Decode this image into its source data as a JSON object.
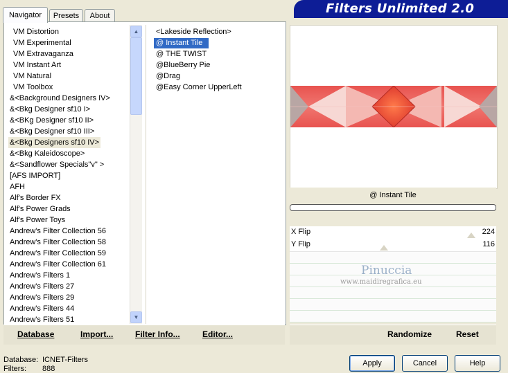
{
  "app_title": "Filters Unlimited 2.0",
  "tabs": [
    "Navigator",
    "Presets",
    "About"
  ],
  "categories": [
    "VM Distortion",
    "VM Experimental",
    "VM Extravaganza",
    "VM Instant Art",
    "VM Natural",
    "VM Toolbox",
    "&<Background Designers IV>",
    "&<Bkg Designer sf10 I>",
    "&<BKg Designer sf10 II>",
    "&<Bkg Designer sf10 III>",
    "&<Bkg Designers sf10 IV>",
    "&<Bkg Kaleidoscope>",
    "&<Sandflower Specials\"v\" >",
    "[AFS IMPORT]",
    "AFH",
    "Alf's Border FX",
    "Alf's Power Grads",
    "Alf's Power Toys",
    "Andrew's Filter Collection 56",
    "Andrew's Filter Collection 58",
    "Andrew's Filter Collection 59",
    "Andrew's Filter Collection 61",
    "Andrew's Filters 1",
    "Andrew's Filters 27",
    "Andrew's Filters 29",
    "Andrew's Filters 44",
    "Andrew's Filters 51"
  ],
  "filters": [
    "<Lakeside Reflection>",
    "@ Instant Tile",
    "@ THE TWIST",
    "@BlueBerry Pie",
    "@Drag",
    "@Easy Corner UpperLeft"
  ],
  "selected_filter_name": "@ Instant Tile",
  "sliders": [
    {
      "label": "X Flip",
      "value": "224"
    },
    {
      "label": "Y Flip",
      "value": "116"
    }
  ],
  "watermark": {
    "line1": "Pinuccia",
    "line2": "www.maidiregrafica.eu"
  },
  "toolbar_left": [
    "Database",
    "Import...",
    "Filter Info...",
    "Editor..."
  ],
  "toolbar_right": [
    "Randomize",
    "Reset"
  ],
  "status": {
    "database_label": "Database:",
    "database_value": "ICNET-Filters",
    "filters_label": "Filters:",
    "filters_value": "888"
  },
  "dialog_buttons": [
    "Apply",
    "Cancel",
    "Help"
  ],
  "colors": {
    "banner": "#0d1d96",
    "selection": "#316ac5",
    "tile_red": "#e8534f",
    "tile_pink": "#f3b4b0"
  }
}
